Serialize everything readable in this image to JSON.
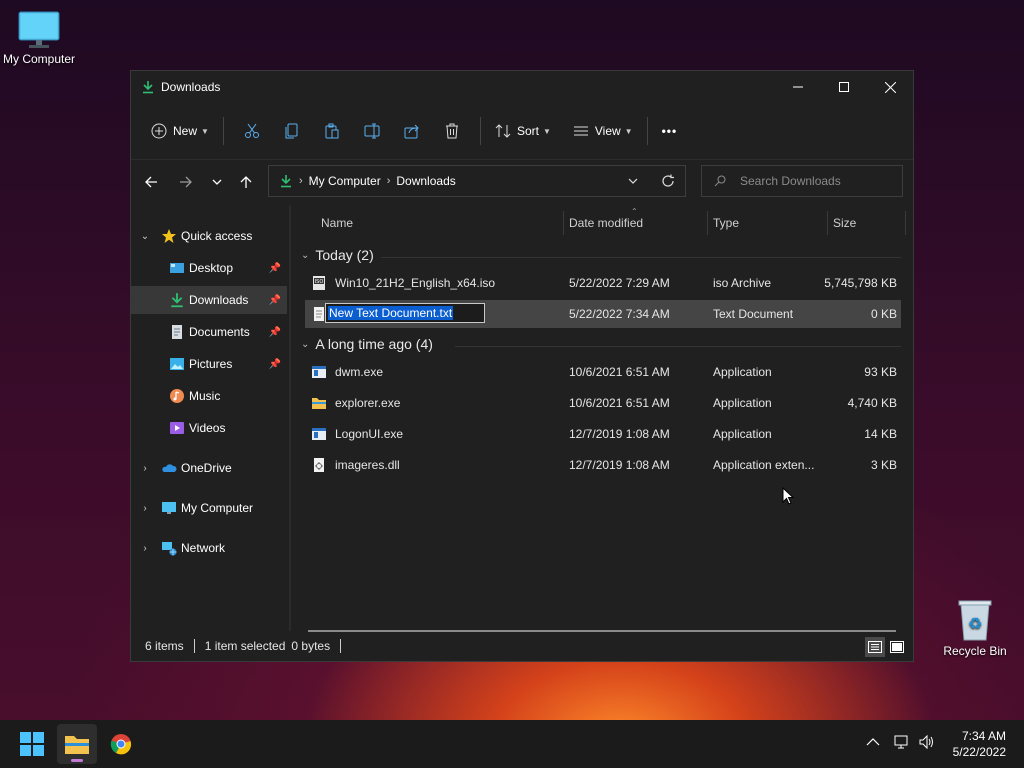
{
  "desktop": {
    "icons": [
      {
        "label": "My Computer"
      },
      {
        "label": "Recycle Bin"
      }
    ]
  },
  "window": {
    "title": "Downloads",
    "commands": {
      "new_label": "New",
      "sort_label": "Sort",
      "view_label": "View",
      "more_label": "•••"
    },
    "breadcrumb": [
      "My Computer",
      "Downloads"
    ],
    "search_placeholder": "Search Downloads",
    "nav": {
      "quick_access": "Quick access",
      "items": [
        {
          "label": "Desktop",
          "pinned": true
        },
        {
          "label": "Downloads",
          "pinned": true,
          "selected": true
        },
        {
          "label": "Documents",
          "pinned": true
        },
        {
          "label": "Pictures",
          "pinned": true
        },
        {
          "label": "Music"
        },
        {
          "label": "Videos"
        }
      ],
      "onedrive": "OneDrive",
      "my_computer": "My Computer",
      "network": "Network"
    },
    "columns": {
      "name": "Name",
      "date": "Date modified",
      "type": "Type",
      "size": "Size"
    },
    "groups": [
      {
        "header": "Today (2)",
        "files": [
          {
            "name": "Win10_21H2_English_x64.iso",
            "date": "5/22/2022 7:29 AM",
            "type": "iso Archive",
            "size": "5,745,798 KB",
            "icon": "iso-file-icon"
          },
          {
            "name": "New Text Document.txt",
            "date": "5/22/2022 7:34 AM",
            "type": "Text Document",
            "size": "0 KB",
            "icon": "text-file-icon",
            "renaming": true
          }
        ]
      },
      {
        "header": "A long time ago (4)",
        "files": [
          {
            "name": "dwm.exe",
            "date": "10/6/2021 6:51 AM",
            "type": "Application",
            "size": "93 KB",
            "icon": "exe-file-icon"
          },
          {
            "name": "explorer.exe",
            "date": "10/6/2021 6:51 AM",
            "type": "Application",
            "size": "4,740 KB",
            "icon": "folder-app-icon"
          },
          {
            "name": "LogonUI.exe",
            "date": "12/7/2019 1:08 AM",
            "type": "Application",
            "size": "14 KB",
            "icon": "exe-file-icon"
          },
          {
            "name": "imageres.dll",
            "date": "12/7/2019 1:08 AM",
            "type": "Application exten...",
            "size": "3 KB",
            "icon": "dll-file-icon"
          }
        ]
      }
    ],
    "status": {
      "items": "6 items",
      "selected": "1 item selected",
      "bytes": "0 bytes"
    }
  },
  "taskbar": {
    "time": "7:34 AM",
    "date": "5/22/2022"
  },
  "colors": {
    "accent": "#0b5ed0",
    "download_green": "#2fbf71",
    "folder_yellow": "#f2c14e"
  }
}
